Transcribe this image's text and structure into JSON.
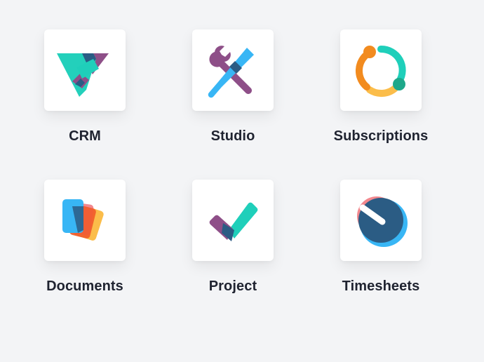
{
  "apps": [
    {
      "label": "CRM",
      "icon": "crm-icon"
    },
    {
      "label": "Studio",
      "icon": "studio-icon"
    },
    {
      "label": "Subscriptions",
      "icon": "subscriptions-icon"
    },
    {
      "label": "Documents",
      "icon": "documents-icon"
    },
    {
      "label": "Project",
      "icon": "project-icon"
    },
    {
      "label": "Timesheets",
      "icon": "timesheets-icon"
    }
  ],
  "colors": {
    "background": "#f3f4f6",
    "tile": "#ffffff",
    "label": "#1f2330",
    "teal": "#1fcfba",
    "purple": "#8e4f88",
    "navy": "#2b5c84",
    "blue": "#38b6f5",
    "orange": "#f28b1f",
    "yellow": "#fbbd4a",
    "green": "#1ea88a",
    "pink": "#f2888e",
    "red_orange": "#f15a2a"
  }
}
